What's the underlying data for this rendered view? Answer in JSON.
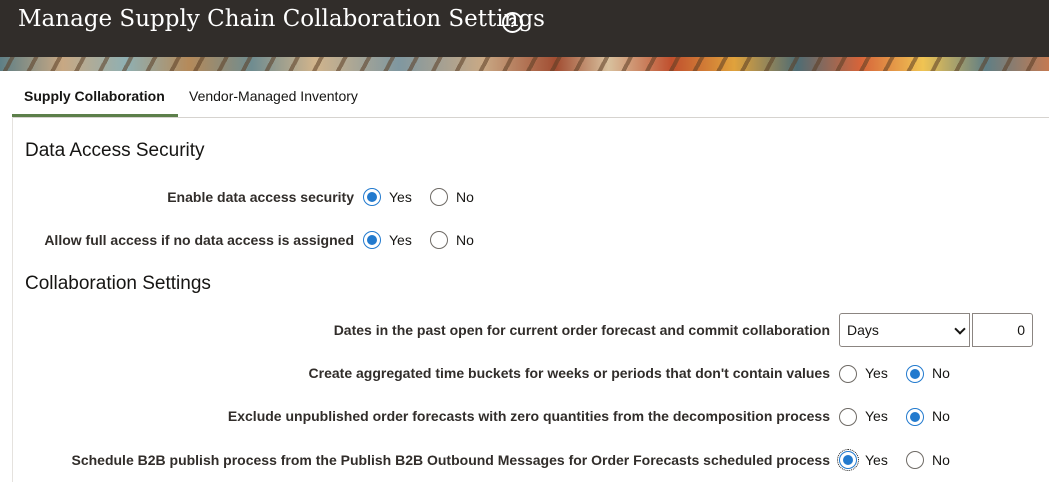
{
  "header": {
    "title": "Manage Supply Chain Collaboration Settings",
    "help_icon": "?"
  },
  "tabs": [
    {
      "label": "Supply Collaboration",
      "active": true
    },
    {
      "label": "Vendor-Managed Inventory",
      "active": false
    }
  ],
  "data_access": {
    "title": "Data Access Security",
    "rows": [
      {
        "label": "Enable data access security",
        "yes": "Yes",
        "no": "No",
        "selected": "Yes"
      },
      {
        "label": "Allow full access if no data access is assigned",
        "yes": "Yes",
        "no": "No",
        "selected": "Yes"
      }
    ]
  },
  "collaboration": {
    "title": "Collaboration Settings",
    "dates_row": {
      "label": "Dates in the past open for current order forecast and commit collaboration",
      "unit": "Days",
      "value": "0"
    },
    "rows": [
      {
        "label": "Create aggregated time buckets for weeks or periods that don't contain values",
        "yes": "Yes",
        "no": "No",
        "selected": "No"
      },
      {
        "label": "Exclude unpublished order forecasts with zero quantities from the decomposition process",
        "yes": "Yes",
        "no": "No",
        "selected": "No"
      },
      {
        "label": "Schedule B2B publish process from the Publish B2B Outbound Messages for Order Forecasts scheduled process",
        "yes": "Yes",
        "no": "No",
        "selected": "Yes"
      }
    ]
  },
  "colors": {
    "accent": "#227ace",
    "header_bg": "#312d2a",
    "tab_underline": "#5c7f4a"
  }
}
